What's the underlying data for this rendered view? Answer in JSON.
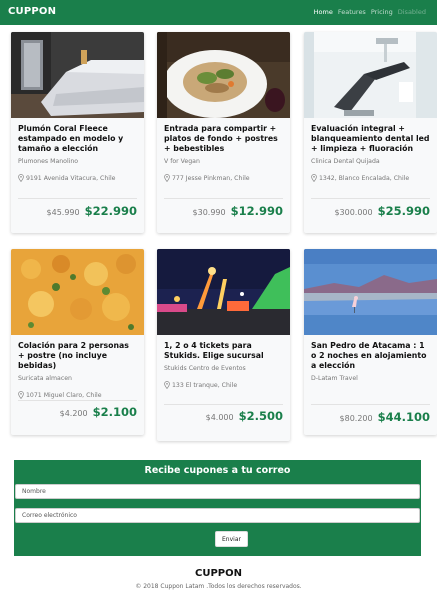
{
  "nav": {
    "brand": "CUPPON",
    "links": [
      "Home",
      "Features",
      "Pricing",
      "Disabled"
    ]
  },
  "deals": [
    {
      "title": "Plumón Coral Fleece estampado en modelo y tamaño a elección",
      "seller": "Plumones Manolino",
      "address": "9191 Avenida Vitacura, Chile",
      "old_price": "$45.990",
      "new_price": "$22.990",
      "image": "bedroom"
    },
    {
      "title": "Entrada para compartir + platos de fondo + postres + bebestibles",
      "seller": "V for Vegan",
      "address": "777 Jesse Pinkman, Chile",
      "old_price": "$30.990",
      "new_price": "$12.990",
      "image": "food-plate"
    },
    {
      "title": "Evaluación integral + blanqueamiento dental led + limpieza + fluoración",
      "seller": "Clinica Dental Quijada",
      "address": "1342, Blanco Encalada, Chile",
      "old_price": "$300.000",
      "new_price": "$25.990",
      "image": "dental-chair"
    },
    {
      "title": "Colación para 2 personas + postre (no incluye bebidas)",
      "seller": "Suricata almacen",
      "address": "1071 Miguel Claro, Chile",
      "old_price": "$4.200",
      "new_price": "$2.100",
      "image": "stew"
    },
    {
      "title": "1, 2 o 4 tickets para Stukids. Elige sucursal",
      "seller": "Stukids Centro de Eventos",
      "address": "133 El tranque, Chile",
      "old_price": "$4.000",
      "new_price": "$2.500",
      "image": "fair-night"
    },
    {
      "title": "San Pedro de Atacama : 1 o 2 noches en alojamiento a elección",
      "seller": "D-Latam Travel",
      "address": "",
      "old_price": "$80.200",
      "new_price": "$44.100",
      "image": "lake-flamingos"
    }
  ],
  "newsletter": {
    "title": "Recibe cupones a tu correo",
    "name_placeholder": "Nombre",
    "email_placeholder": "Correo electrónico",
    "submit_label": "Enviar"
  },
  "footer": {
    "brand": "CUPPON",
    "copyright": "© 2018 Cuppon Latam .Todos los derechos reservados."
  },
  "colors": {
    "brand_green": "#1a7f4b",
    "card_bg": "#f8f9fa"
  }
}
